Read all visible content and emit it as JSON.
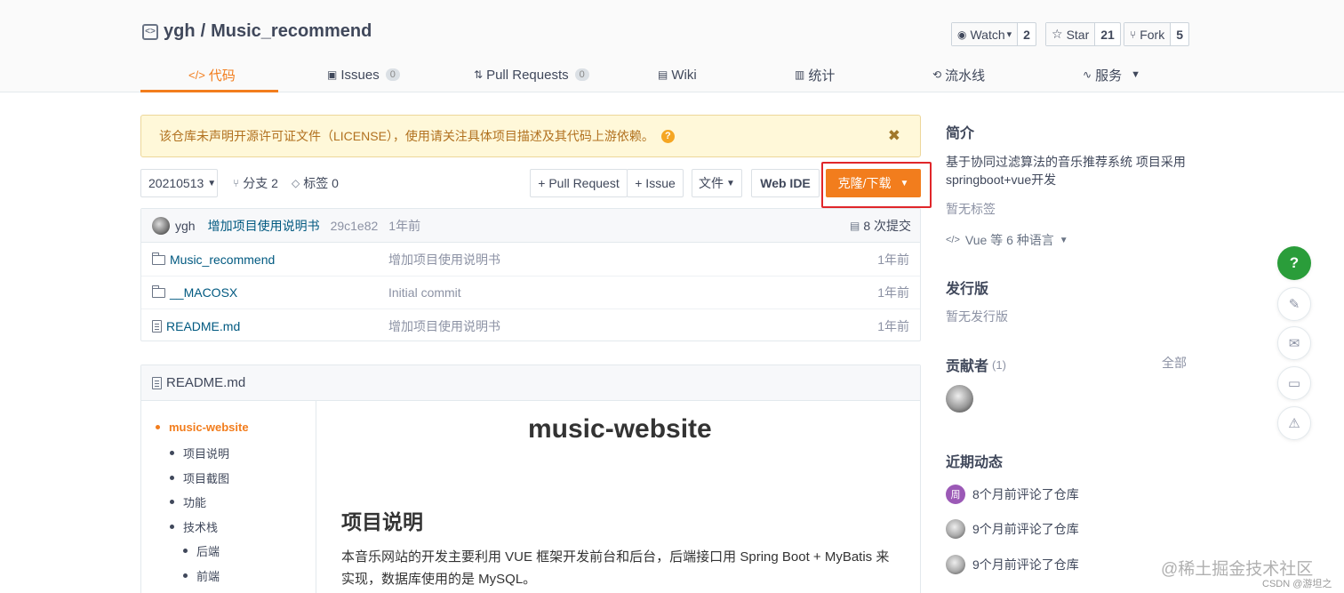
{
  "repo": {
    "owner": "ygh",
    "separator": "/",
    "name": "Music_recommend"
  },
  "social": [
    {
      "label": "Watch",
      "icon": "eye-icon",
      "caret": "▾",
      "count": "2"
    },
    {
      "label": "Star",
      "icon": "star-icon",
      "caret": "",
      "count": "21"
    },
    {
      "label": "Fork",
      "icon": "fork-icon",
      "caret": "",
      "count": "5"
    }
  ],
  "tabs": [
    {
      "label": "代码",
      "icon": "code-icon",
      "count": ""
    },
    {
      "label": "Issues",
      "icon": "issues-icon",
      "count": "0"
    },
    {
      "label": "Pull Requests",
      "icon": "pull-request-icon",
      "count": "0"
    },
    {
      "label": "Wiki",
      "icon": "wiki-icon",
      "count": ""
    },
    {
      "label": "统计",
      "icon": "stats-icon",
      "count": ""
    },
    {
      "label": "流水线",
      "icon": "pipeline-icon",
      "count": ""
    },
    {
      "label": "服务",
      "icon": "service-icon",
      "count": ""
    }
  ],
  "notice": {
    "text": "该仓库未声明开源许可证文件（LICENSE），使用请关注具体项目描述及其代码上游依赖。",
    "help": "?",
    "close": "✖"
  },
  "toolbar": {
    "branch": "20210513",
    "branches": "分支 2",
    "tags": "标签 0",
    "pull_request": "+ Pull Request",
    "issue": "+ Issue",
    "file": "文件",
    "web_ide": "Web IDE",
    "clone": "克隆/下载"
  },
  "commit": {
    "author": "ygh",
    "message": "增加项目使用说明书",
    "hash": "29c1e82",
    "time": "1年前",
    "commits": "8 次提交"
  },
  "files": [
    {
      "name": "Music_recommend",
      "type": "folder",
      "message": "增加项目使用说明书",
      "time": "1年前"
    },
    {
      "name": "__MACOSX",
      "type": "folder",
      "message": "Initial commit",
      "time": "1年前"
    },
    {
      "name": "README.md",
      "type": "file",
      "message": "增加项目使用说明书",
      "time": "1年前"
    }
  ],
  "readme": {
    "filename": "README.md",
    "toc": [
      "music-website",
      "项目说明",
      "项目截图",
      "功能",
      "技术栈",
      "后端",
      "前端"
    ],
    "title": "music-website",
    "h2": "项目说明",
    "paragraph": "本音乐网站的开发主要利用 VUE 框架开发前台和后台，后端接口用 Spring Boot + MyBatis 来实现，数据库使用的是 MySQL。"
  },
  "sidebar": {
    "intro_title": "简介",
    "intro": "基于协同过滤算法的音乐推荐系统 项目采用springboot+vue开发",
    "no_tags": "暂无标签",
    "language": "Vue 等 6 种语言",
    "release_title": "发行版",
    "no_release": "暂无发行版",
    "contrib_title": "贡献者",
    "contrib_count": "(1)",
    "all": "全部",
    "activity_title": "近期动态",
    "activities": [
      {
        "avatar": "周",
        "text": "8个月前评论了仓库"
      },
      {
        "avatar": "",
        "text": "9个月前评论了仓库"
      },
      {
        "avatar": "",
        "text": "9个月前评论了仓库"
      }
    ]
  },
  "floating": [
    "help-icon",
    "edit-icon",
    "mail-icon",
    "chat-icon",
    "warning-icon"
  ],
  "watermark": {
    "main": "@稀土掘金技术社区",
    "small": "CSDN @游坦之"
  },
  "colors": {
    "accent": "#f27d1d",
    "link": "#005980",
    "help": "#2a9d3a",
    "highlight": "#e0262a"
  }
}
